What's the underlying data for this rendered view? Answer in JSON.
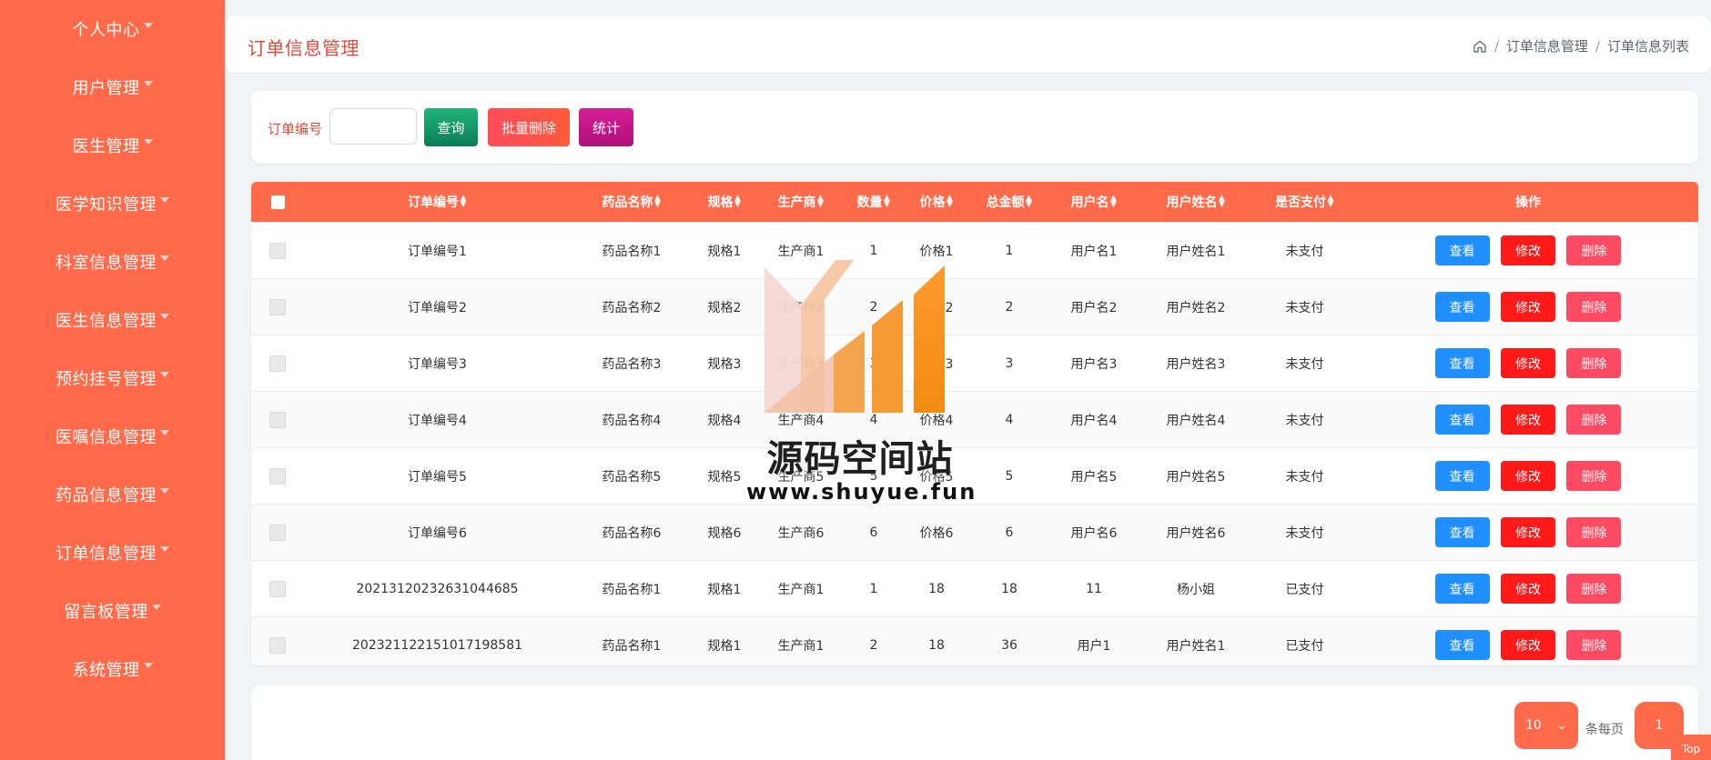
{
  "sidebar": {
    "items": [
      {
        "label": "个人中心"
      },
      {
        "label": "用户管理"
      },
      {
        "label": "医生管理"
      },
      {
        "label": "医学知识管理"
      },
      {
        "label": "科室信息管理"
      },
      {
        "label": "医生信息管理"
      },
      {
        "label": "预约挂号管理"
      },
      {
        "label": "医嘱信息管理"
      },
      {
        "label": "药品信息管理"
      },
      {
        "label": "订单信息管理"
      },
      {
        "label": "留言板管理"
      },
      {
        "label": "系统管理"
      }
    ]
  },
  "header": {
    "title": "订单信息管理",
    "breadcrumb": {
      "home_icon": "home-icon",
      "separator": "/",
      "item1": "订单信息管理",
      "item2": "订单信息列表"
    }
  },
  "filter": {
    "label": "订单编号",
    "input_value": "",
    "input_placeholder": "",
    "query_label": "查询",
    "batch_delete_label": "批量删除",
    "stats_label": "统计"
  },
  "table": {
    "headers": {
      "order_no": "订单编号",
      "drug_name": "药品名称",
      "spec": "规格",
      "manufacturer": "生产商",
      "quantity": "数量",
      "price": "价格",
      "total": "总金额",
      "username": "用户名",
      "real_name": "用户姓名",
      "paid": "是否支付",
      "actions": "操作"
    },
    "rows": [
      {
        "order_no": "订单编号1",
        "drug_name": "药品名称1",
        "spec": "规格1",
        "manufacturer": "生产商1",
        "quantity": "1",
        "price": "价格1",
        "total": "1",
        "username": "用户名1",
        "real_name": "用户姓名1",
        "paid": "未支付"
      },
      {
        "order_no": "订单编号2",
        "drug_name": "药品名称2",
        "spec": "规格2",
        "manufacturer": "生产商2",
        "quantity": "2",
        "price": "价格2",
        "total": "2",
        "username": "用户名2",
        "real_name": "用户姓名2",
        "paid": "未支付"
      },
      {
        "order_no": "订单编号3",
        "drug_name": "药品名称3",
        "spec": "规格3",
        "manufacturer": "生产商3",
        "quantity": "3",
        "price": "价格3",
        "total": "3",
        "username": "用户名3",
        "real_name": "用户姓名3",
        "paid": "未支付"
      },
      {
        "order_no": "订单编号4",
        "drug_name": "药品名称4",
        "spec": "规格4",
        "manufacturer": "生产商4",
        "quantity": "4",
        "price": "价格4",
        "total": "4",
        "username": "用户名4",
        "real_name": "用户姓名4",
        "paid": "未支付"
      },
      {
        "order_no": "订单编号5",
        "drug_name": "药品名称5",
        "spec": "规格5",
        "manufacturer": "生产商5",
        "quantity": "5",
        "price": "价格5",
        "total": "5",
        "username": "用户名5",
        "real_name": "用户姓名5",
        "paid": "未支付"
      },
      {
        "order_no": "订单编号6",
        "drug_name": "药品名称6",
        "spec": "规格6",
        "manufacturer": "生产商6",
        "quantity": "6",
        "price": "价格6",
        "total": "6",
        "username": "用户名6",
        "real_name": "用户姓名6",
        "paid": "未支付"
      },
      {
        "order_no": "20213120232631044685",
        "drug_name": "药品名称1",
        "spec": "规格1",
        "manufacturer": "生产商1",
        "quantity": "1",
        "price": "18",
        "total": "18",
        "username": "11",
        "real_name": "杨小姐",
        "paid": "已支付"
      },
      {
        "order_no": "20232112215101719858​1",
        "drug_name": "药品名称1",
        "spec": "规格1",
        "manufacturer": "生产商1",
        "quantity": "2",
        "price": "18",
        "total": "36",
        "username": "用户1",
        "real_name": "用户姓名1",
        "paid": "已支付"
      }
    ],
    "actions": {
      "view": "查看",
      "edit": "修改",
      "delete": "删除"
    },
    "sort_icon": "sort-icon",
    "checkbox_icon": "checkbox-icon"
  },
  "pagination": {
    "page_size": "10",
    "per_page_label": "条每页",
    "current_page": "1",
    "to_top_label": "Top"
  },
  "watermark": {
    "title": "源码空间站",
    "url": "www.shuyue.fun",
    "logo_icon": "bar-logo-icon"
  },
  "colors": {
    "sidebar_bg": "#ff6a4a",
    "title_color": "#e14a3b",
    "table_header_bg": "#ff6a4a",
    "view_button": "#1f8fff",
    "edit_button": "#ff1919",
    "delete_button": "#ff4a64"
  }
}
